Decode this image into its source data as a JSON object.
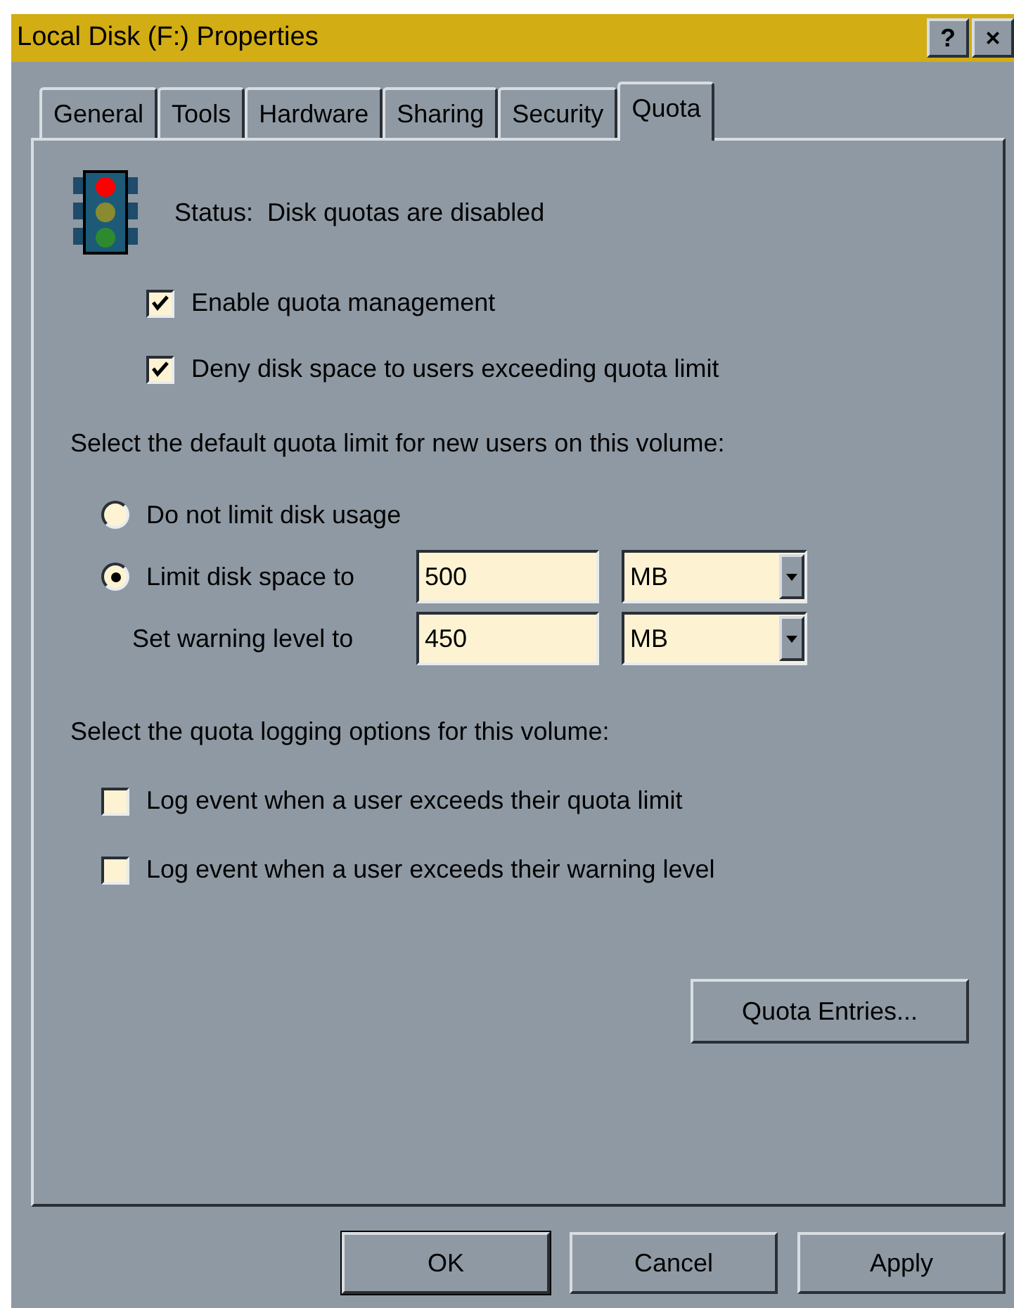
{
  "window": {
    "title": "Local Disk (F:) Properties",
    "title_buttons": [
      "?",
      "×"
    ]
  },
  "tabs": [
    {
      "label": "General",
      "selected": false
    },
    {
      "label": "Tools",
      "selected": false
    },
    {
      "label": "Hardware",
      "selected": false
    },
    {
      "label": "Sharing",
      "selected": false
    },
    {
      "label": "Security",
      "selected": false
    },
    {
      "label": "Quota",
      "selected": true
    }
  ],
  "status": "Status:  Disk quotas are disabled",
  "options": [
    {
      "label": "Enable quota management",
      "checked": true
    },
    {
      "label": "Deny disk space to users exceeding quota limit",
      "checked": true
    }
  ],
  "default_limit_heading": "Select the default quota limit for new users on this volume:",
  "radios": [
    {
      "label": "Do not limit disk usage",
      "selected": false
    },
    {
      "label": "Limit disk space to",
      "selected": true,
      "value": "500",
      "unit": "MB"
    }
  ],
  "warning": {
    "label": "Set warning level to",
    "value": "450",
    "unit": "MB"
  },
  "logging_heading": "Select the quota logging options for this volume:",
  "logging": [
    {
      "label": "Log event when a user exceeds their quota limit",
      "checked": false
    },
    {
      "label": "Log event when a user exceeds their warning level",
      "checked": false
    }
  ],
  "entries_button": "Quota Entries...",
  "buttons": [
    "OK",
    "Cancel",
    "Apply"
  ]
}
